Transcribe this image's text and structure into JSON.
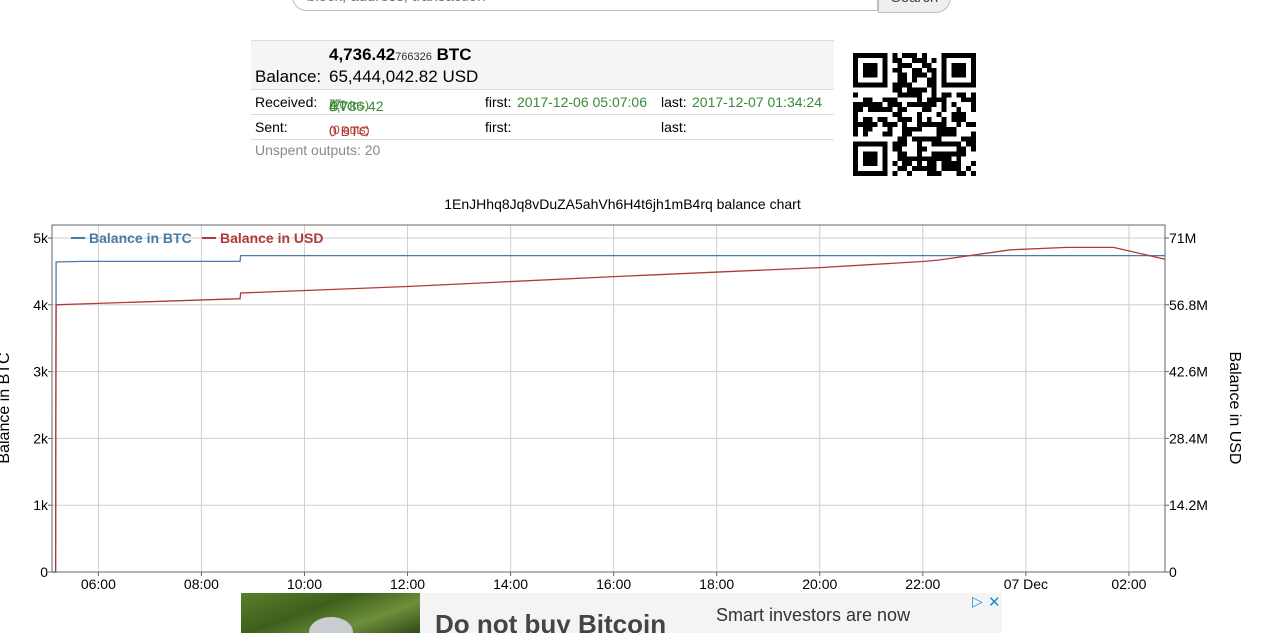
{
  "search": {
    "placeholder": "block, address, transaction",
    "button_label": "Search"
  },
  "balance": {
    "label": "Balance:",
    "btc_main": "4,736.42",
    "btc_small": "766326",
    "btc_unit": " BTC",
    "usd": "65,444,042.82 USD"
  },
  "received": {
    "label": "Received:",
    "amount_main": "4,736.42",
    "amount_small": "77",
    "amount_unit": " BTC ",
    "count": "(20 ins)",
    "first_label": "first:",
    "first_value": "2017-12-06 05:07:06",
    "last_label": "last:",
    "last_value": "2017-12-07 01:34:24"
  },
  "sent": {
    "label": "Sent:",
    "amount": "0 BTC ",
    "count": "(0 outs)",
    "first_label": "first:",
    "last_label": "last:"
  },
  "unspent": "Unspent outputs: 20",
  "qr_icon": "qr-code-icon",
  "chart_data": {
    "type": "line",
    "title": "1EnJHhq8Jq8vDuZA5ahVh6H4t6jh1mB4rq balance chart",
    "ylabel_left": "Balance in BTC",
    "ylabel_right": "Balance in USD",
    "x_ticks": [
      "06:00",
      "08:00",
      "10:00",
      "12:00",
      "14:00",
      "16:00",
      "18:00",
      "20:00",
      "22:00",
      "07 Dec",
      "02:00"
    ],
    "y_left_ticks": [
      "0",
      "1k",
      "2k",
      "3k",
      "4k",
      "5k"
    ],
    "y_left_range": [
      0,
      5000
    ],
    "y_right_ticks": [
      "0",
      "14.2M",
      "28.4M",
      "42.6M",
      "56.8M",
      "71M"
    ],
    "y_right_range": [
      0,
      71000000
    ],
    "x_range_hours": [
      5.1,
      26.7
    ],
    "grid": true,
    "legend_position": "top-left",
    "series": [
      {
        "name": "Balance in BTC",
        "color": "#4a7aa8",
        "axis": "left",
        "x": [
          5.12,
          5.17,
          5.18,
          5.7,
          8.75,
          8.76,
          26.7
        ],
        "values": [
          0,
          0,
          4640,
          4650,
          4650,
          4736,
          4736
        ]
      },
      {
        "name": "Balance in USD",
        "color": "#b03a3a",
        "axis": "right",
        "x": [
          5.12,
          5.17,
          5.18,
          5.7,
          8.75,
          8.76,
          12,
          16,
          20,
          22,
          22.3,
          23.7,
          24.8,
          25.7,
          26.7
        ],
        "values": [
          0,
          0,
          56800000,
          57000000,
          58100000,
          59300000,
          60700000,
          62800000,
          64700000,
          66000000,
          66300000,
          68500000,
          69000000,
          69000000,
          66500000
        ]
      }
    ]
  },
  "ad": {
    "headline": "Do not buy Bitcoin",
    "sub": "Smart investors are now",
    "play_icon": "ad-choices-icon",
    "close_icon": "close-icon"
  }
}
